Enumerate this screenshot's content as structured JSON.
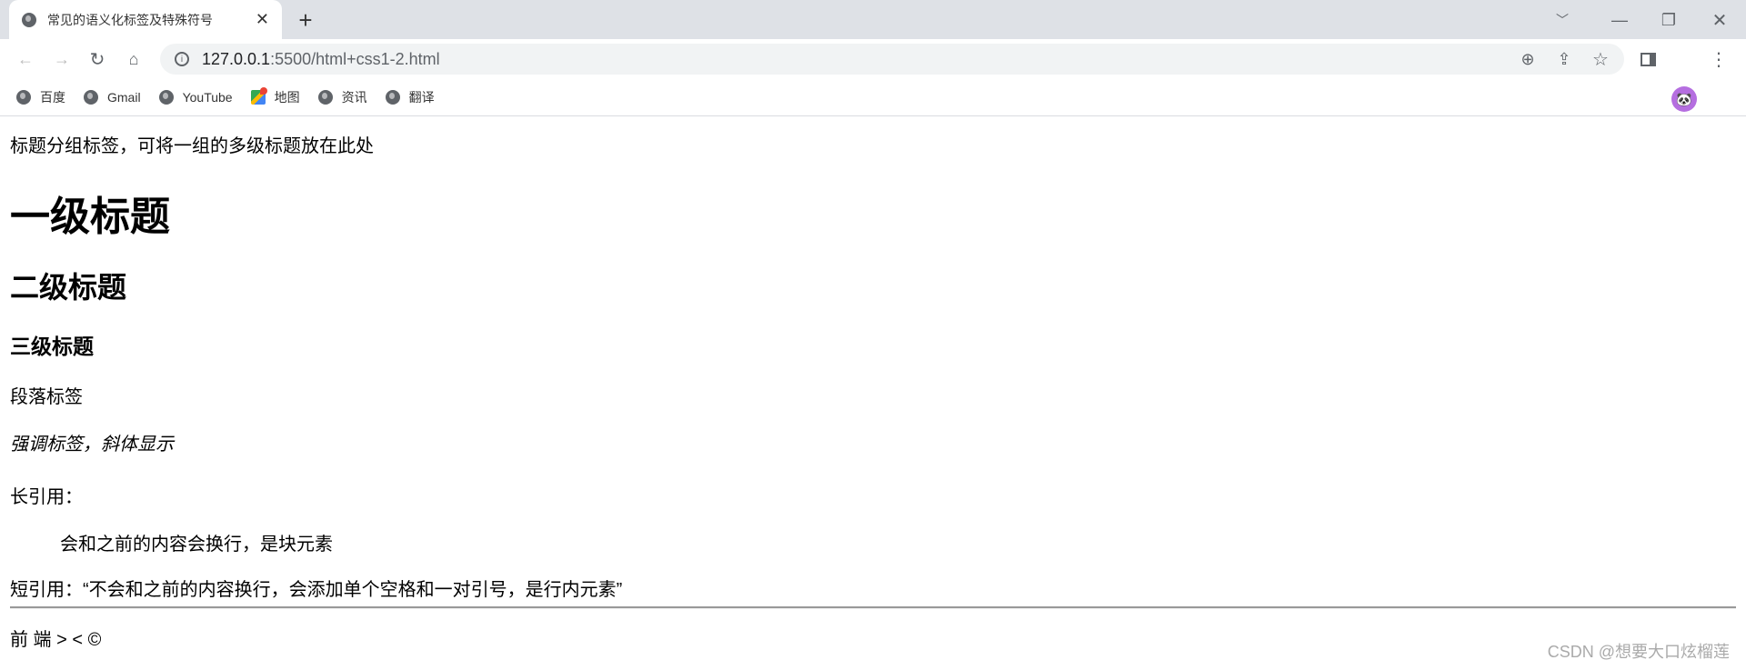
{
  "browser": {
    "tab_title": "常见的语义化标签及特殊符号",
    "url_host": "127.0.0.1",
    "url_rest": ":5500/html+css1-2.html",
    "bookmarks": [
      {
        "label": "百度",
        "icon": "globe-icon"
      },
      {
        "label": "Gmail",
        "icon": "globe-icon"
      },
      {
        "label": "YouTube",
        "icon": "globe-icon"
      },
      {
        "label": "地图",
        "icon": "maps-icon"
      },
      {
        "label": "资讯",
        "icon": "globe-icon"
      },
      {
        "label": "翻译",
        "icon": "globe-icon"
      }
    ]
  },
  "page": {
    "hgroup_text": "标题分组标签，可将一组的多级标题放在此处",
    "h1": "一级标题",
    "h2": "二级标题",
    "h3": "三级标题",
    "paragraph": "段落标签",
    "em": "强调标签，斜体显示",
    "blockquote_label": "长引用：",
    "blockquote": "会和之前的内容会换行，是块元素",
    "q_line": "短引用：“不会和之前的内容换行，会添加单个空格和一对引号，是行内元素”",
    "entities": "前 端 > < ©",
    "watermark": "CSDN @想要大口炫榴莲"
  }
}
